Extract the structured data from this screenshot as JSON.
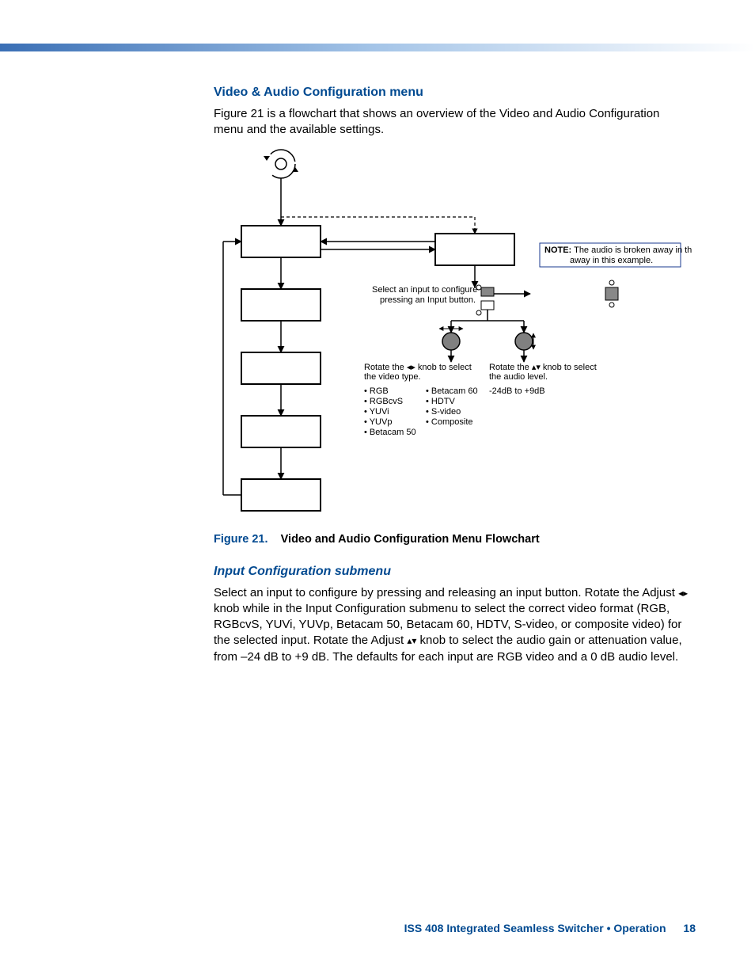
{
  "section1": {
    "heading": "Video & Audio Configuration menu",
    "para": "Figure 21 is a flowchart that shows an overview of the Video and Audio Configuration menu and the available settings."
  },
  "figure": {
    "caption_num": "Figure 21.",
    "caption_text": "Video and Audio Configuration Menu Flowchart",
    "note_label": "NOTE:",
    "note_text": "The audio is broken away in this example.",
    "sel_line1": "Select an input to configure",
    "sel_line2": "pressing an Input button.",
    "rotate_h_1": "Rotate the",
    "rotate_h_2": "knob to select",
    "rotate_h_3": "the video type.",
    "rotate_v_1": "Rotate the",
    "rotate_v_2": "knob to select",
    "rotate_v_3": "the audio level.",
    "types_col1": [
      "RGB",
      "RGBcvS",
      "YUVi",
      "YUVp",
      "Betacam 50"
    ],
    "types_col2": [
      "Betacam 60",
      "HDTV",
      "S-video",
      "Composite"
    ],
    "audio_range": "-24dB to +9dB"
  },
  "section2": {
    "heading": "Input Configuration submenu",
    "p1a": "Select an input to configure by pressing and releasing an input button. Rotate the Adjust ",
    "p1b": " knob while in the Input Configuration submenu to select the correct video format (RGB, RGBcvS, YUVi, YUVp, Betacam 50, Betacam 60, HDTV, S-video, or composite video) for the selected input. Rotate the Adjust ",
    "p1c": " knob to select the audio gain or attenuation value, from –24 dB to +9 dB. The defaults for each input are RGB video and a 0 dB audio level."
  },
  "footer": {
    "text": "ISS 408 Integrated Seamless Switcher • Operation",
    "page": "18"
  }
}
